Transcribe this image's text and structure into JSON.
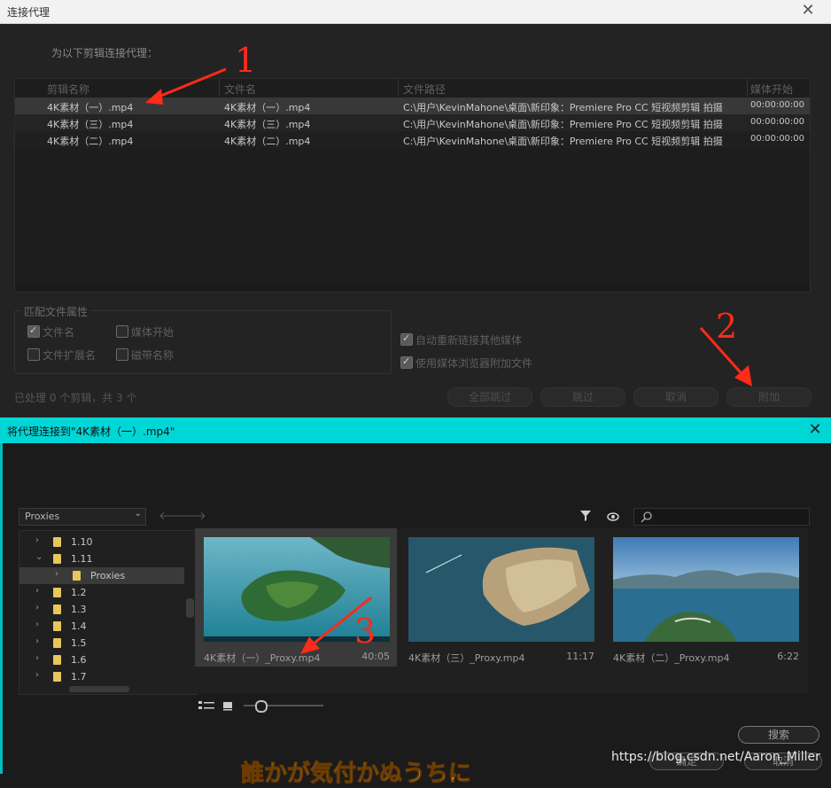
{
  "top_dialog": {
    "title": "连接代理",
    "instruction": "为以下剪辑连接代理：",
    "columns": [
      "剪辑名称",
      "文件名",
      "文件路径",
      "媒体开始"
    ],
    "rows": [
      {
        "clip": "4K素材（一）.mp4",
        "file": "4K素材（一）.mp4",
        "path": "C:\\用户\\KevinMahone\\桌面\\新印象：Premiere Pro CC 短视频剪辑 拍摄",
        "start": "00:00:00:00"
      },
      {
        "clip": "4K素材（三）.mp4",
        "file": "4K素材（三）.mp4",
        "path": "C:\\用户\\KevinMahone\\桌面\\新印象：Premiere Pro CC 短视频剪辑 拍摄",
        "start": "00:00:00:00"
      },
      {
        "clip": "4K素材（二）.mp4",
        "file": "4K素材（二）.mp4",
        "path": "C:\\用户\\KevinMahone\\桌面\\新印象：Premiere Pro CC 短视频剪辑 拍摄",
        "start": "00:00:00:00"
      }
    ],
    "match_group": {
      "legend": "匹配文件属性",
      "options": [
        {
          "label": "文件名",
          "checked": true
        },
        {
          "label": "媒体开始",
          "checked": false
        },
        {
          "label": "文件扩展名",
          "checked": false
        },
        {
          "label": "磁带名称",
          "checked": false
        }
      ]
    },
    "auto_relink": {
      "label": "自动重新链接其他媒体",
      "checked": true
    },
    "use_browser": {
      "label": "使用媒体浏览器附加文件",
      "checked": true
    },
    "processed": "已处理 0 个剪辑，共 3 个",
    "buttons": {
      "skip_all": "全部跳过",
      "skip": "跳过",
      "cancel": "取消",
      "attach": "附加"
    }
  },
  "bottom_dialog": {
    "title": "将代理连接到\"4K素材（一）.mp4\"",
    "folder_select": "Proxies",
    "tree": [
      {
        "label": "1.10",
        "expanded": false,
        "indent": 0
      },
      {
        "label": "1.11",
        "expanded": true,
        "indent": 0
      },
      {
        "label": "Proxies",
        "expanded": false,
        "indent": 1
      },
      {
        "label": "1.2",
        "expanded": false,
        "indent": 0
      },
      {
        "label": "1.3",
        "expanded": false,
        "indent": 0
      },
      {
        "label": "1.4",
        "expanded": false,
        "indent": 0
      },
      {
        "label": "1.5",
        "expanded": false,
        "indent": 0
      },
      {
        "label": "1.6",
        "expanded": false,
        "indent": 0
      },
      {
        "label": "1.7",
        "expanded": false,
        "indent": 0
      }
    ],
    "thumbnails": [
      {
        "name": "4K素材（一）_Proxy.mp4",
        "duration": "40:05",
        "selected": true
      },
      {
        "name": "4K素材（三）_Proxy.mp4",
        "duration": "11:17",
        "selected": false
      },
      {
        "name": "4K素材（二）_Proxy.mp4",
        "duration": "6:22",
        "selected": false
      }
    ],
    "buttons": {
      "search": "搜索",
      "ok": "确定",
      "cancel": "取消"
    }
  },
  "annotations": {
    "step1": "1",
    "step2": "2",
    "step3": "3"
  },
  "watermark": "https://blog.csdn.net/Aaron_Miller",
  "subtitle": "誰かが気付かぬうちに",
  "colors": {
    "accent_titlebar": "#00d6d6",
    "annotation": "#ff2a1a",
    "folder": "#e8c65a"
  }
}
